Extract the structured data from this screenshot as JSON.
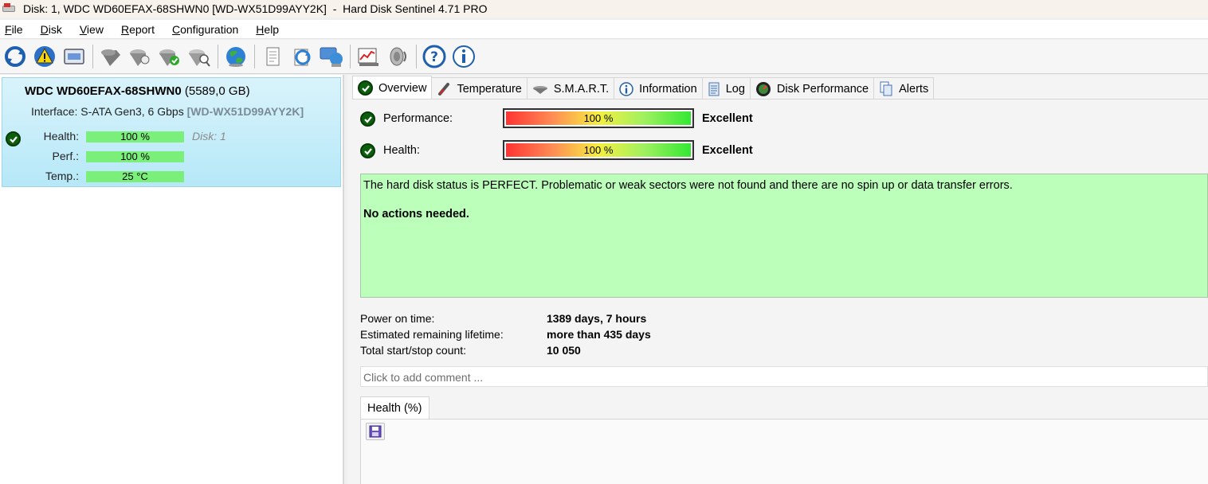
{
  "window": {
    "title": "Disk: 1, WDC WD60EFAX-68SHWN0 [WD-WX51D99AYY2K]  -  Hard Disk Sentinel 4.71 PRO"
  },
  "menu": [
    {
      "mnemonic": "F",
      "rest": "ile"
    },
    {
      "mnemonic": "D",
      "rest": "isk"
    },
    {
      "mnemonic": "V",
      "rest": "iew"
    },
    {
      "mnemonic": "R",
      "rest": "eport"
    },
    {
      "mnemonic": "C",
      "rest": "onfiguration"
    },
    {
      "mnemonic": "H",
      "rest": "elp"
    }
  ],
  "toolbar_icons": [
    "refresh-icon",
    "alert-icon",
    "disk-details-icon",
    "disk-test-icon",
    "surface-test-icon",
    "disk-ok-icon",
    "disk-search-icon",
    "globe-icon",
    "report-icon",
    "send-report-icon",
    "network-icon",
    "performance-chart-icon",
    "acoustic-icon",
    "help-icon",
    "info-icon"
  ],
  "disk_card": {
    "model": "WDC WD60EFAX-68SHWN0",
    "capacity": "(5589,0 GB)",
    "interface_label": "Interface:",
    "interface_value": "S-ATA Gen3, 6 Gbps",
    "serial": "[WD-WX51D99AYY2K]",
    "health_label": "Health:",
    "health_value": "100 %",
    "perf_label": "Perf.:",
    "perf_value": "100 %",
    "temp_label": "Temp.:",
    "temp_value": "25 °C",
    "disk_num": "Disk: 1"
  },
  "tabs": [
    {
      "label": "Overview",
      "icon": "check-icon",
      "active": true
    },
    {
      "label": "Temperature",
      "icon": "thermometer-icon"
    },
    {
      "label": "S.M.A.R.T.",
      "icon": "smart-icon"
    },
    {
      "label": "Information",
      "icon": "info-icon"
    },
    {
      "label": "Log",
      "icon": "log-icon"
    },
    {
      "label": "Disk Performance",
      "icon": "speedometer-icon"
    },
    {
      "label": "Alerts",
      "icon": "alerts-icon"
    }
  ],
  "overview": {
    "performance_label": "Performance:",
    "performance_value": "100 %",
    "performance_percent": 100,
    "performance_rating": "Excellent",
    "health_label": "Health:",
    "health_value": "100 %",
    "health_percent": 100,
    "health_rating": "Excellent",
    "status_text": "The hard disk status is PERFECT. Problematic or weak sectors were not found and there are no spin up or data transfer errors.",
    "action_text": "No actions needed.",
    "info": [
      {
        "key": "Power on time:",
        "value": "1389 days, 7 hours"
      },
      {
        "key": "Estimated remaining lifetime:",
        "value": "more than 435 days"
      },
      {
        "key": "Total start/stop count:",
        "value": "10 050"
      }
    ],
    "comment_placeholder": "Click to add comment ...",
    "health_chart_tab": "Health (%)"
  },
  "colors": {
    "ok_green": "#0d5f0d",
    "status_bg": "#bbffbb",
    "card_bg": "#b6e8f8",
    "mini_bar": "#7af07a"
  }
}
